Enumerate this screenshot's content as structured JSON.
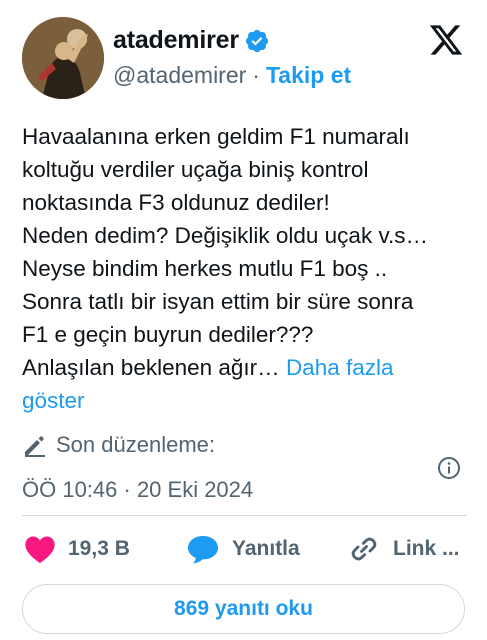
{
  "author": {
    "name": "atademirer",
    "handle": "@atademirer",
    "separator": "·",
    "follow_label": "Takip et"
  },
  "tweet": {
    "lines": [
      "Havaalanına erken geldim F1 numaralı",
      "koltuğu verdiler uçağa biniş kontrol",
      "noktasında F3 oldunuz dediler!",
      "Neden dedim? Değişiklik oldu uçak v.s…",
      "Neyse bindim herkes mutlu F1 boş ..",
      "Sonra tatlı bir isyan ettim bir süre sonra",
      "F1 e geçin buyrun dediler???",
      "Anlaşılan beklenen ağır…"
    ],
    "show_more_first": "Daha fazla",
    "show_more_second": "göster"
  },
  "meta": {
    "edited_label": "Son düzenleme:",
    "timestamp": "ÖÖ 10:46 · 20 Eki 2024"
  },
  "actions": {
    "likes": "19,3 B",
    "reply_label": "Yanıtla",
    "copy_label": "Link ..."
  },
  "replies_button": "869 yanıtı oku",
  "colors": {
    "accent": "#1d9bf0",
    "like": "#f91880",
    "secondary_text": "#536471",
    "border": "#cfd9de"
  },
  "icons": {
    "brand": "x-logo-icon",
    "verified": "verified-badge-icon",
    "edit": "pencil-icon",
    "info": "info-icon",
    "like": "heart-icon",
    "reply": "reply-bubble-icon",
    "copy": "link-icon"
  }
}
